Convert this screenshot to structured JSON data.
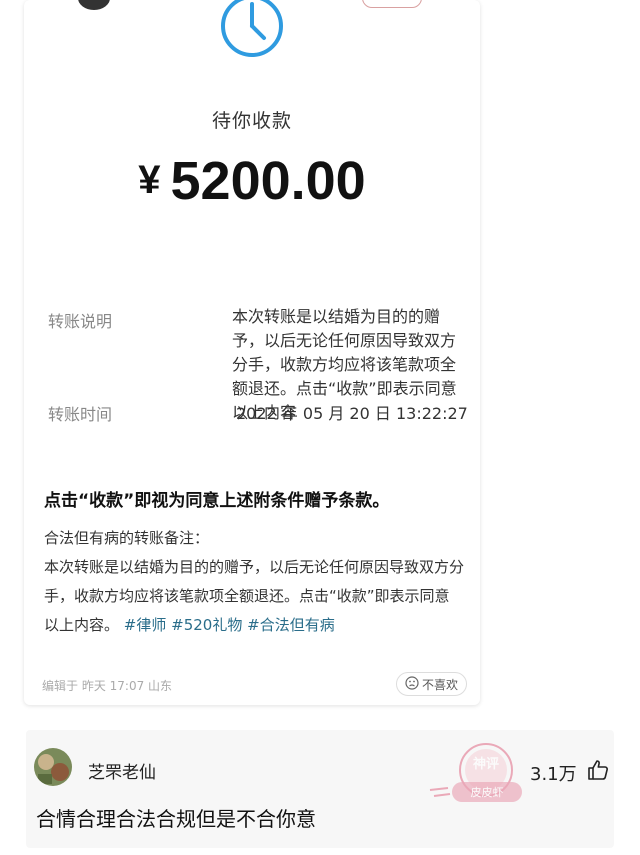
{
  "transfer": {
    "status_label": "待你收款",
    "currency_symbol": "¥",
    "amount": "5200.00",
    "description_label": "转账说明",
    "description_value": "本次转账是以结婚为目的的赠予，以后无论任何原因导致双方分手，收款方均应将该笔款项全额退还。点击“收款”即表示同意以上内容",
    "time_label": "转账时间",
    "time_value": "2022 年 05 月 20 日 13:22:27"
  },
  "post": {
    "title": "点击“收款”即视为同意上述附条件赠予条款。",
    "body_intro": "合法但有病的转账备注：",
    "body_text": "本次转账是以结婚为目的的赠予，以后无论任何原因导致双方分手，收款方均应将该笔款项全额退还。点击“收款”即表示同意以上内容。",
    "hashtags": [
      "#律师",
      "#520礼物",
      "#合法但有病"
    ],
    "meta": "编辑于 昨天 17:07 山东",
    "dislike_label": "不喜欢"
  },
  "comment": {
    "username": "芝罘老仙",
    "text": "合情合理合法合规但是不合你意",
    "like_count": "3.1万"
  },
  "watermark": {
    "line1": "神评",
    "line2": "皮皮虾"
  },
  "icons": {
    "clock": "clock-icon",
    "dislike": "sad-face-icon",
    "like": "thumbs-up-icon"
  },
  "colors": {
    "clock_blue": "#2f9be0",
    "hashtag": "#2a6d8a",
    "watermark": "#e06a86"
  }
}
